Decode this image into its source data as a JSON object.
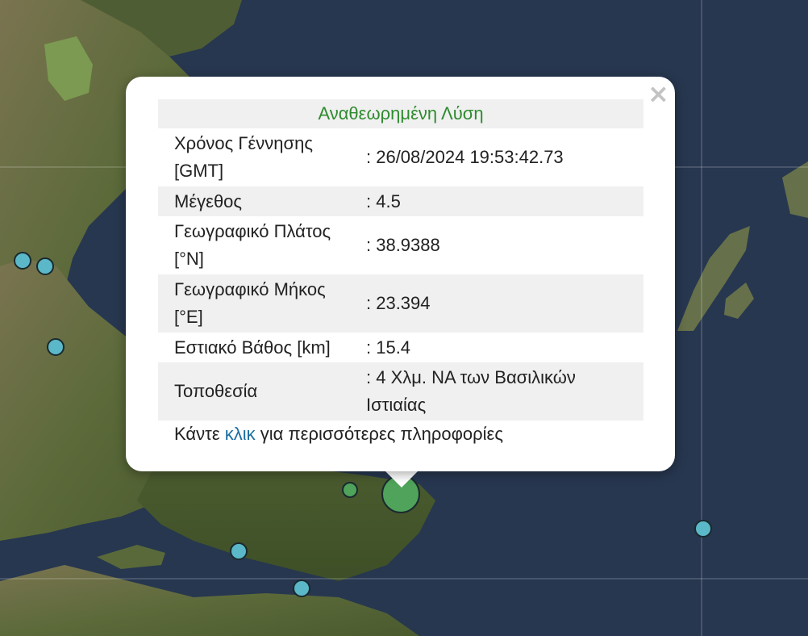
{
  "popup": {
    "title": "Αναθεωρημένη Λύση",
    "close_glyph": "×",
    "rows": [
      {
        "label": "Χρόνος Γέννησης [GMT]",
        "value": ": 26/08/2024 19:53:42.73"
      },
      {
        "label": "Μέγεθος",
        "value": ": 4.5"
      },
      {
        "label": "Γεωγραφικό Πλάτος [°N]",
        "value": ": 38.9388"
      },
      {
        "label": "Γεωγραφικό Μήκος [°E]",
        "value": ": 23.394"
      },
      {
        "label": "Εστιακό Βάθος [km]",
        "value": ": 15.4"
      },
      {
        "label": "Τοποθεσία",
        "value": ": 4 Χλμ. ΝΑ των Βασιλικών Ιστιαίας"
      }
    ],
    "footer_prefix": "Κάντε ",
    "footer_link": "κλικ",
    "footer_suffix": " για περισσότερες πληροφορίες"
  },
  "colors": {
    "title_green": "#2e8b2e",
    "link_blue": "#1a6ea0",
    "marker_cyan": "#5bb8c8",
    "marker_green": "#4fa35a",
    "sea": "#2a3b55",
    "land": "#5f6a3e"
  },
  "icons": {
    "close": "close-icon"
  }
}
